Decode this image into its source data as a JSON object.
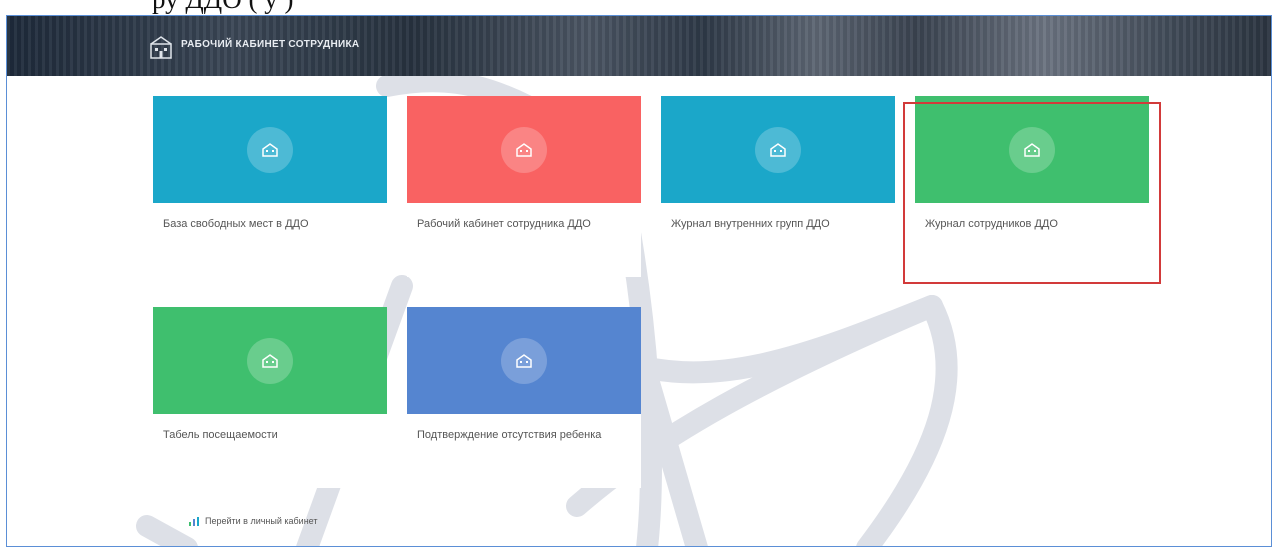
{
  "caption": "ру     ДДО (   у   )",
  "header": {
    "title": "РАБОЧИЙ КАБИНЕТ СОТРУДНИКА",
    "logo_icon": "building-logo-icon"
  },
  "tiles": [
    {
      "label": "База свободных мест в ДДО",
      "color": "#1ba7c9",
      "icon": "building-icon"
    },
    {
      "label": "Рабочий кабинет сотрудника ДДО",
      "color": "#f96262",
      "icon": "building-icon"
    },
    {
      "label": "Журнал внутренних групп ДДО",
      "color": "#1ba7c9",
      "icon": "building-icon"
    },
    {
      "label": "Журнал сотрудников ДДО",
      "color": "#3fbf6e",
      "icon": "building-icon",
      "selected": true
    },
    {
      "label": "Табель посещаемости",
      "color": "#3fbf6e",
      "icon": "building-icon"
    },
    {
      "label": "Подтверждение отсутствия ребенка",
      "color": "#5585d0",
      "icon": "building-icon"
    }
  ],
  "footer": {
    "link_label": "Перейти в личный кабинет",
    "icon": "chart-bars-icon"
  },
  "colors": {
    "frame_border": "#5b8fd6",
    "selection_border": "#d23a3a"
  }
}
